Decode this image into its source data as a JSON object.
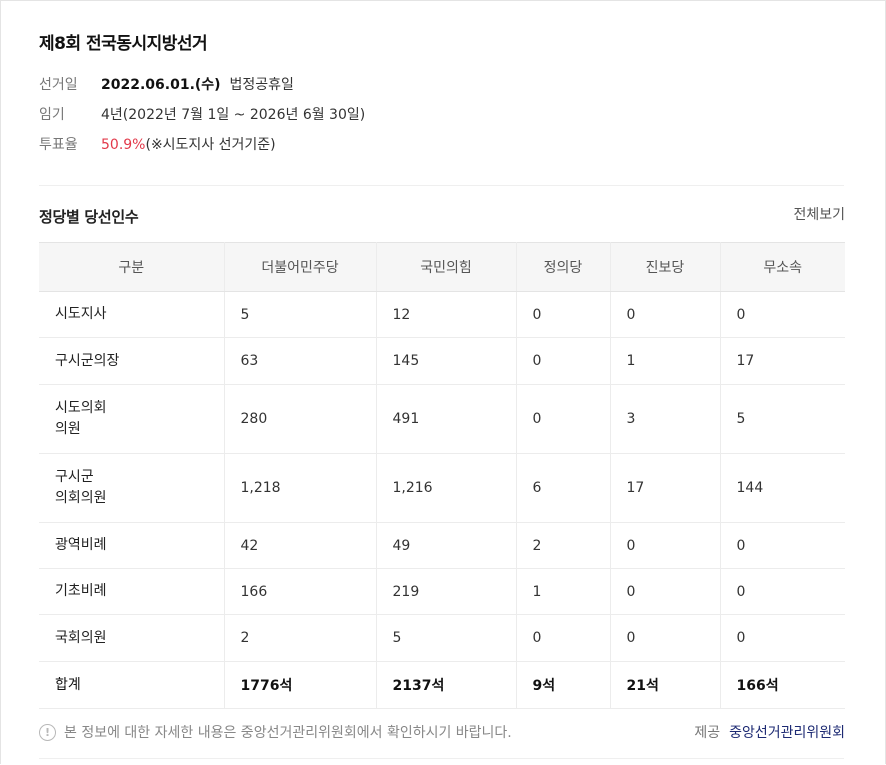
{
  "title": "제8회 전국동시지방선거",
  "info": {
    "election_day_label": "선거일",
    "election_day_value": "2022.06.01.(수)",
    "election_day_note": "법정공휴일",
    "term_label": "임기",
    "term_value": "4년(2022년 7월 1일 ~ 2026년 6월 30일)",
    "turnout_label": "투표율",
    "turnout_value": "50.9%",
    "turnout_note": "(※시도지사 선거기준)"
  },
  "section": {
    "title": "정당별 당선인수",
    "view_all": "전체보기"
  },
  "table": {
    "headers": [
      "구분",
      "더불어민주당",
      "국민의힘",
      "정의당",
      "진보당",
      "무소속"
    ],
    "rows": [
      {
        "cat1": "시도지사",
        "cat2": "",
        "vals": [
          "5",
          "12",
          "0",
          "0",
          "0"
        ]
      },
      {
        "cat1": "구시군의장",
        "cat2": "",
        "vals": [
          "63",
          "145",
          "0",
          "1",
          "17"
        ]
      },
      {
        "cat1": "시도의회",
        "cat2": "의원",
        "vals": [
          "280",
          "491",
          "0",
          "3",
          "5"
        ]
      },
      {
        "cat1": "구시군",
        "cat2": "의회의원",
        "vals": [
          "1,218",
          "1,216",
          "6",
          "17",
          "144"
        ]
      },
      {
        "cat1": "광역비례",
        "cat2": "",
        "vals": [
          "42",
          "49",
          "2",
          "0",
          "0"
        ]
      },
      {
        "cat1": "기초비례",
        "cat2": "",
        "vals": [
          "166",
          "219",
          "1",
          "0",
          "0"
        ]
      },
      {
        "cat1": "국회의원",
        "cat2": "",
        "vals": [
          "2",
          "5",
          "0",
          "0",
          "0"
        ]
      }
    ],
    "total": {
      "label": "합계",
      "vals": [
        "1776석",
        "2137석",
        "9석",
        "21석",
        "166석"
      ]
    }
  },
  "footer": {
    "notice": "본 정보에 대한 자세한 내용은 중앙선거관리위원회에서 확인하시기 바랍니다.",
    "provider_label": "제공",
    "provider_name": "중앙선거관리위원회"
  },
  "icons": {
    "notice": "info-exclamation-icon"
  },
  "colors": {
    "accent_red": "#e2394a",
    "provider_link": "#1d2a73"
  }
}
